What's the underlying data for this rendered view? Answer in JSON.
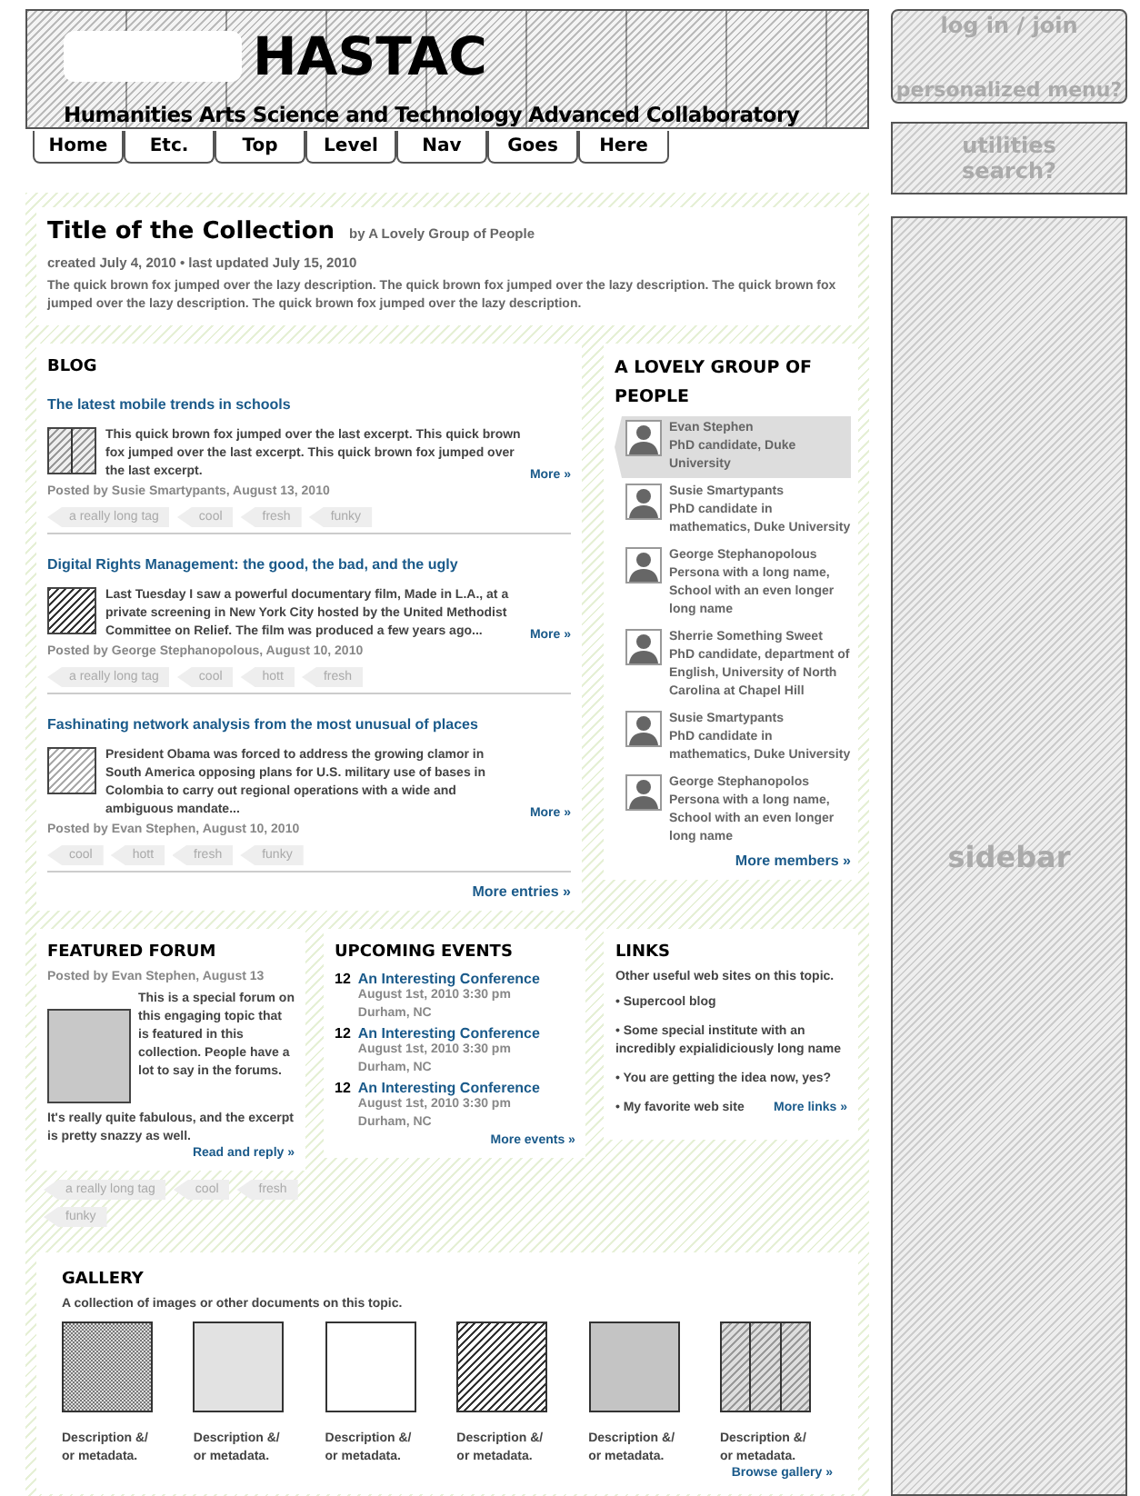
{
  "header": {
    "logo": "HASTAC",
    "tagline": "Humanities Arts Science and Technology Advanced Collaboratory",
    "nav": [
      "Home",
      "Etc.",
      "Top",
      "Level",
      "Nav",
      "Goes",
      "Here"
    ]
  },
  "account": {
    "login": "log in / join",
    "menu": "personalized menu?"
  },
  "utilities": {
    "label": "utilities",
    "search": "search?"
  },
  "sidebar": {
    "label": "sidebar"
  },
  "collection": {
    "title": "Title of the Collection",
    "byline": "by A Lovely Group of People",
    "meta": "created July 4, 2010 • last updated July 15, 2010",
    "description": "The quick brown fox jumped over the lazy description. The quick brown fox jumped over the lazy description. The quick brown fox jumped over the lazy description. The quick brown fox jumped over the lazy description."
  },
  "blog": {
    "heading": "BLOG",
    "entries": [
      {
        "title": "The latest mobile trends in schools",
        "excerpt": "This quick brown fox jumped over the last excerpt. This quick brown fox jumped over the last excerpt. This quick brown fox jumped over the last excerpt.",
        "more": "More »",
        "posted": "Posted by Susie Smartypants,  August 13, 2010",
        "tags": [
          "a really long tag",
          "cool",
          "fresh",
          "funky"
        ]
      },
      {
        "title": "Digital Rights Management: the good, the bad, and the ugly",
        "excerpt": "Last Tuesday I saw a powerful documentary film, Made in L.A., at a private screening in New York City hosted by the United Methodist Committee on Relief. The film was produced a few years ago...",
        "more": "More »",
        "posted": "Posted by George Stephanopolous, August 10, 2010",
        "tags": [
          "a really long tag",
          "cool",
          "hott",
          "fresh"
        ]
      },
      {
        "title": "Fashinating network analysis from the most unusual of places",
        "excerpt": "President Obama was forced to address the growing clamor in South America opposing plans for U.S. military use of bases in Colombia to carry out regional operations with a wide and ambiguous mandate...",
        "more": "More »",
        "posted": "Posted by Evan Stephen, August 10, 2010",
        "tags": [
          "cool",
          "hott",
          "fresh",
          "funky"
        ]
      }
    ],
    "more": "More entries »"
  },
  "people": {
    "heading": "A LOVELY GROUP OF PEOPLE",
    "members": [
      {
        "name": "Evan Stephen",
        "detail": "PhD candidate, Duke University",
        "selected": true
      },
      {
        "name": "Susie Smartypants",
        "detail": "PhD candidate in mathematics, Duke University",
        "selected": false
      },
      {
        "name": "George Stephanopolous",
        "detail": "Persona with a long name, School with an even longer long name",
        "selected": false
      },
      {
        "name": "Sherrie Something Sweet",
        "detail": "PhD candidate, department of English, University of North Carolina at Chapel Hill",
        "selected": false
      },
      {
        "name": "Susie Smartypants",
        "detail": "PhD candidate in mathematics, Duke University",
        "selected": false
      },
      {
        "name": "George Stephanopolos",
        "detail": "Persona with a long name, School with an even longer long name",
        "selected": false
      }
    ],
    "more": "More members »"
  },
  "forum": {
    "heading": "FEATURED FORUM",
    "posted": "Posted by Evan Stephen, August 13",
    "body": "This is a special forum on this engaging topic that is featured in this collection. People have a lot to say in the forums.",
    "body2": "It's really quite fabulous, and the excerpt is pretty snazzy as well.",
    "link": "Read and reply »",
    "tags": [
      "a really long tag",
      "cool",
      "fresh",
      "funky"
    ]
  },
  "events": {
    "heading": "UPCOMING EVENTS",
    "items": [
      {
        "day": "12",
        "title": "An Interesting Conference",
        "when": "August 1st, 2010 3:30 pm",
        "where": "Durham, NC"
      },
      {
        "day": "12",
        "title": "An Interesting Conference",
        "when": "August 1st, 2010 3:30 pm",
        "where": "Durham, NC"
      },
      {
        "day": "12",
        "title": "An Interesting Conference",
        "when": "August 1st, 2010 3:30 pm",
        "where": "Durham, NC"
      }
    ],
    "more": "More events »"
  },
  "links": {
    "heading": "LINKS",
    "intro": "Other useful web sites on this topic.",
    "items": [
      "• Supercool blog",
      "• Some special institute with an incredibly expialidiciously long name",
      "• You are getting the idea now, yes?",
      "• My favorite web site"
    ],
    "more": "More links »"
  },
  "gallery": {
    "heading": "GALLERY",
    "intro": "A collection of images or other documents on this topic.",
    "items": [
      {
        "kind": "picture",
        "caption": "Description &/ or metadata."
      },
      {
        "kind": "picture",
        "caption": "Description &/ or metadata."
      },
      {
        "kind": "picture",
        "caption": "Description &/ or metadata."
      },
      {
        "kind": "picture",
        "caption": "Description &/ or metadata."
      },
      {
        "kind": "picture",
        "caption": "Description &/ or metadata."
      },
      {
        "kind": "picture",
        "caption": "Description &/ or metadata."
      }
    ],
    "more": "Browse gallery »"
  }
}
